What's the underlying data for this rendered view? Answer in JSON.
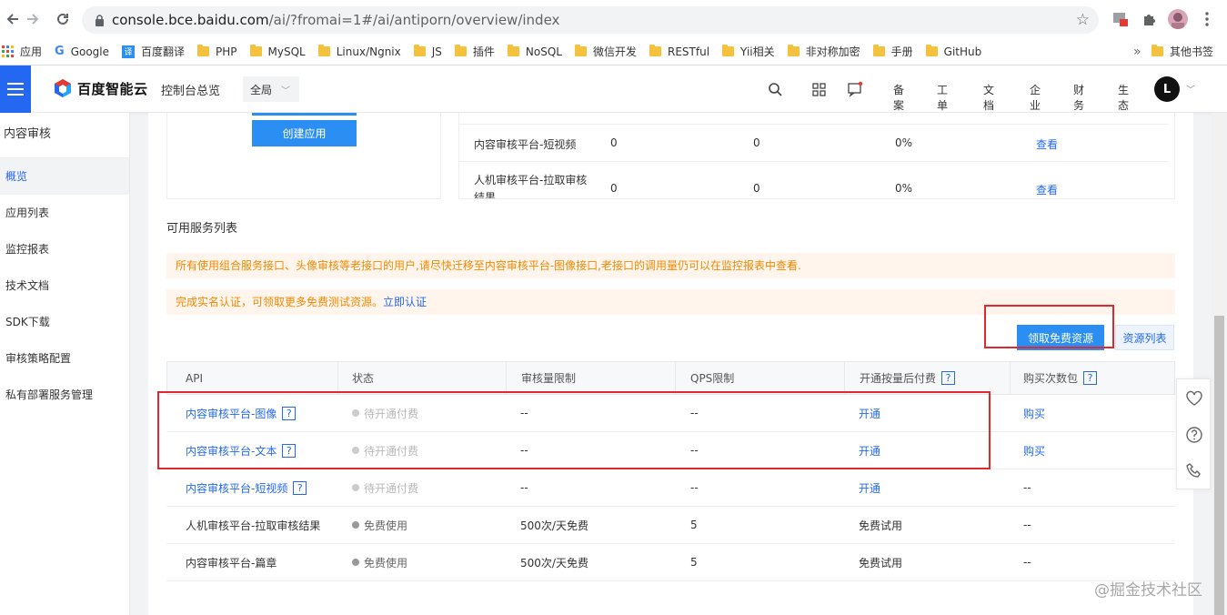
{
  "browser": {
    "url_host": "console.bce.baidu.com",
    "url_path": "/ai/?fromai=1#/ai/antiporn/overview/index"
  },
  "bookmarks": [
    "应用",
    "Google",
    "百度翻译",
    "PHP",
    "MySQL",
    "Linux/Ngnix",
    "JS",
    "插件",
    "NoSQL",
    "微信开发",
    "RESTful",
    "Yii相关",
    "非对称加密",
    "手册",
    "GitHub"
  ],
  "bookmarks_more": "»",
  "bookmarks_other": "其他书签",
  "header": {
    "logo_text": "百度智能云",
    "console_home": "控制台总览",
    "region": "全局",
    "links": [
      "备案",
      "工单",
      "文档",
      "企业",
      "财务",
      "生态"
    ],
    "avatar_letter": "L"
  },
  "sidebar": {
    "title": "内容审核",
    "items": [
      "概览",
      "应用列表",
      "监控报表",
      "技术文档",
      "SDK下载",
      "审核策略配置",
      "私有部署服务管理"
    ]
  },
  "overview": {
    "create_app": "创建应用",
    "rows": [
      {
        "name": "内容审核平台-短视频",
        "a": "0",
        "b": "0",
        "rate": "0%",
        "action": "查看"
      },
      {
        "name": "人机审核平台-拉取审核结果",
        "a": "0",
        "b": "0",
        "rate": "0%",
        "action": "查看"
      }
    ]
  },
  "services": {
    "title": "可用服务列表",
    "notice1": "所有使用组合服务接口、头像审核等老接口的用户,请尽快迁移至内容审核平台-图像接口,老接口的调用量仍可以在监控报表中查看.",
    "notice2_text": "完成实名认证，可领取更多免费测试资源。",
    "notice2_link": "立即认证",
    "btn_free": "领取免费资源",
    "btn_resources": "资源列表",
    "columns": [
      "API",
      "状态",
      "审核量限制",
      "QPS限制",
      "开通按量后付费",
      "购买次数包"
    ],
    "rows": [
      {
        "api": "内容审核平台-图像",
        "help": true,
        "status": "待开通付费",
        "status_type": "pending",
        "limit": "--",
        "qps": "--",
        "postpay": "开通",
        "postpay_link": true,
        "pack": "购买",
        "pack_link": true
      },
      {
        "api": "内容审核平台-文本",
        "help": true,
        "status": "待开通付费",
        "status_type": "pending",
        "limit": "--",
        "qps": "--",
        "postpay": "开通",
        "postpay_link": true,
        "pack": "购买",
        "pack_link": true
      },
      {
        "api": "内容审核平台-短视频",
        "help": true,
        "status": "待开通付费",
        "status_type": "pending",
        "limit": "--",
        "qps": "--",
        "postpay": "开通",
        "postpay_link": true,
        "pack": "--",
        "pack_link": false
      },
      {
        "api": "人机审核平台-拉取审核结果",
        "help": false,
        "status": "免费使用",
        "status_type": "free",
        "limit": "500次/天免费",
        "qps": "5",
        "postpay": "免费试用",
        "postpay_link": false,
        "pack": "--",
        "pack_link": false
      },
      {
        "api": "内容审核平台-篇章",
        "help": false,
        "status": "免费使用",
        "status_type": "free",
        "limit": "500次/天免费",
        "qps": "5",
        "postpay": "免费试用",
        "postpay_link": false,
        "pack": "--",
        "pack_link": false
      }
    ],
    "help_mark": "?"
  },
  "float_tools": [
    "heart-icon",
    "question-icon",
    "phone-icon"
  ],
  "watermark": "@掘金技术社区",
  "colors": {
    "brand_blue": "#2468f2",
    "button_blue": "#2b8ef3",
    "notice_orange": "#f38900",
    "highlight_red": "#e0292f"
  }
}
